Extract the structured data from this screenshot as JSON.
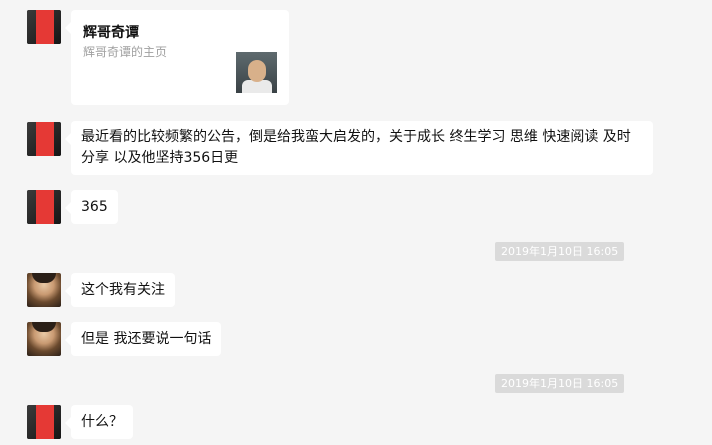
{
  "messages": {
    "card": {
      "title": "辉哥奇谭",
      "subtitle": "辉哥奇谭的主页"
    },
    "msg1": "最近看的比较频繁的公告，倒是给我蛮大启发的，关于成长 终生学习 思维 快速阅读 及时分享 以及他坚持356日更",
    "msg2": "365",
    "time1": "2019年1月10日 16:05",
    "msg3": "这个我有关注",
    "msg4": "但是 我还要说一句话",
    "time2": "2019年1月10日 16:05",
    "msg5": "什么？"
  },
  "icons": {
    "avatar_sender_a": "red-avatar-icon",
    "avatar_sender_b": "portrait-avatar-icon",
    "card_thumbnail": "profile-thumbnail-icon"
  }
}
